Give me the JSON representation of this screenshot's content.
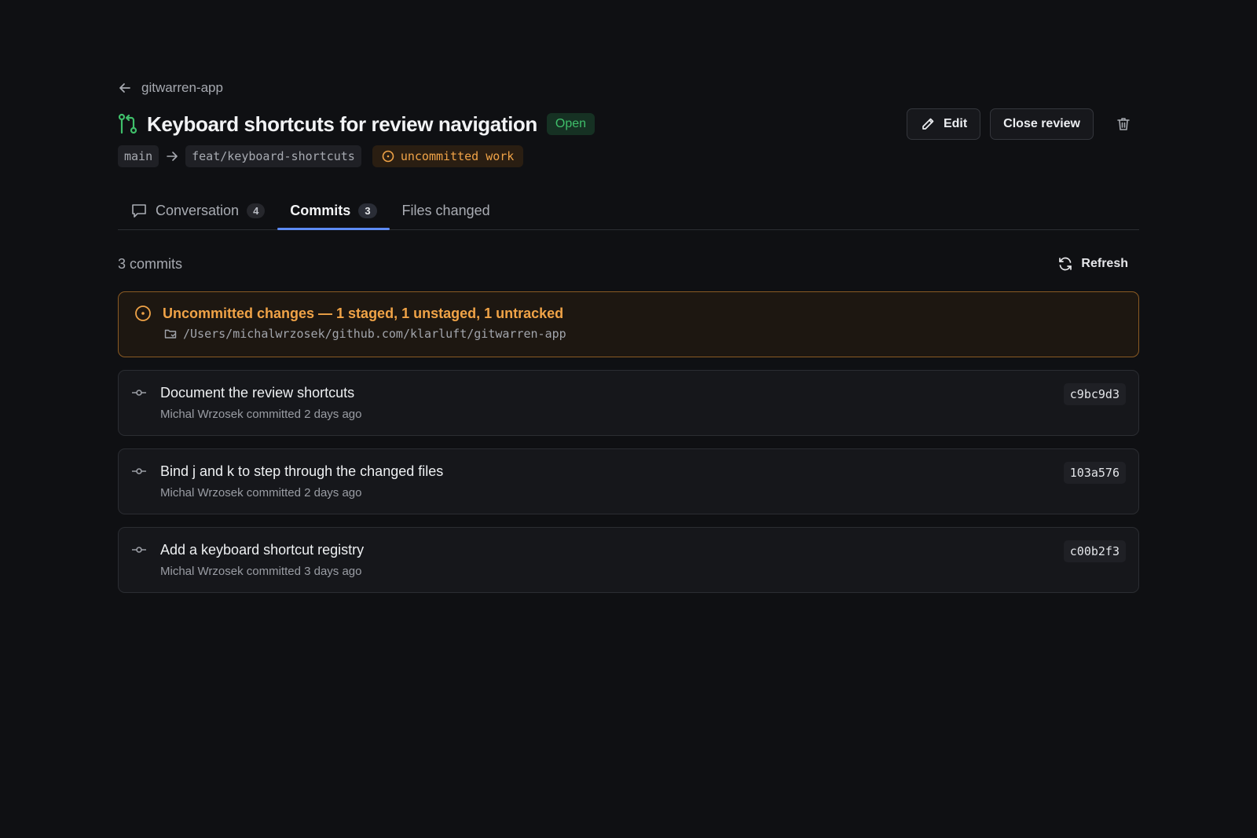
{
  "back": {
    "label": "gitwarren-app"
  },
  "header": {
    "title": "Keyboard shortcuts for review navigation",
    "status": "Open",
    "edit_label": "Edit",
    "close_label": "Close review"
  },
  "branches": {
    "base": "main",
    "head": "feat/keyboard-shortcuts",
    "warning": "uncommitted work"
  },
  "tabs": [
    {
      "label": "Conversation",
      "count": "4"
    },
    {
      "label": "Commits",
      "count": "3"
    },
    {
      "label": "Files changed"
    }
  ],
  "commits_header": {
    "count_label": "3 commits",
    "refresh_label": "Refresh"
  },
  "uncommitted": {
    "title": "Uncommitted changes — 1 staged, 1 unstaged, 1 untracked",
    "path": "/Users/michalwrzosek/github.com/klarluft/gitwarren-app"
  },
  "commits": [
    {
      "message": "Document the review shortcuts",
      "meta": "Michal Wrzosek committed 2 days ago",
      "sha": "c9bc9d3"
    },
    {
      "message": "Bind j and k to step through the changed files",
      "meta": "Michal Wrzosek committed 2 days ago",
      "sha": "103a576"
    },
    {
      "message": "Add a keyboard shortcut registry",
      "meta": "Michal Wrzosek committed 3 days ago",
      "sha": "c00b2f3"
    }
  ],
  "colors": {
    "background": "#0f1013",
    "open_green": "#3fbf6a",
    "warning_orange": "#f0a347",
    "tab_accent": "#5d8bf4"
  }
}
